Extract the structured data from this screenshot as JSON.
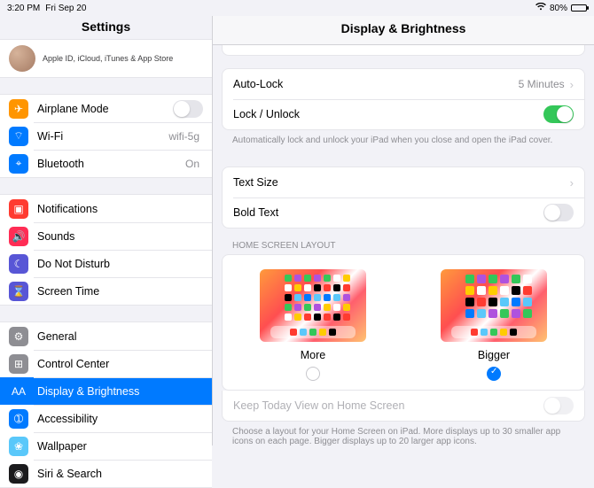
{
  "status": {
    "time": "3:20 PM",
    "date": "Fri Sep 20",
    "battery_pct": "80%"
  },
  "sidebar": {
    "title": "Settings",
    "profile_sub": "Apple ID, iCloud, iTunes & App Store",
    "g1": [
      {
        "label": "Airplane Mode",
        "icon": "✈︎",
        "bg": "#ff9500",
        "switch": "off"
      },
      {
        "label": "Wi-Fi",
        "icon": "⌔",
        "bg": "#007aff",
        "trail": "wifi-5g"
      },
      {
        "label": "Bluetooth",
        "icon": "⌖",
        "bg": "#007aff",
        "trail": "On"
      }
    ],
    "g2": [
      {
        "label": "Notifications",
        "icon": "▣",
        "bg": "#ff3b30"
      },
      {
        "label": "Sounds",
        "icon": "🔊",
        "bg": "#ff2d55"
      },
      {
        "label": "Do Not Disturb",
        "icon": "☾",
        "bg": "#5856d6"
      },
      {
        "label": "Screen Time",
        "icon": "⌛",
        "bg": "#5856d6"
      }
    ],
    "g3": [
      {
        "label": "General",
        "icon": "⚙",
        "bg": "#8e8e93"
      },
      {
        "label": "Control Center",
        "icon": "⊞",
        "bg": "#8e8e93"
      },
      {
        "label": "Display & Brightness",
        "icon": "AA",
        "bg": "#007aff",
        "selected": true
      },
      {
        "label": "Accessibility",
        "icon": "➀",
        "bg": "#007aff"
      },
      {
        "label": "Wallpaper",
        "icon": "❀",
        "bg": "#5ac8fa"
      },
      {
        "label": "Siri & Search",
        "icon": "◉",
        "bg": "#1b1b1d"
      }
    ]
  },
  "detail": {
    "title": "Display & Brightness",
    "autolock_label": "Auto-Lock",
    "autolock_value": "5 Minutes",
    "lockunlock_label": "Lock / Unlock",
    "lockunlock_note": "Automatically lock and unlock your iPad when you close and open the iPad cover.",
    "textsize_label": "Text Size",
    "boldtext_label": "Bold Text",
    "layout_header": "Home Screen Layout",
    "opt_more": "More",
    "opt_bigger": "Bigger",
    "selected_layout": "Bigger",
    "today_label": "Keep Today View on Home Screen",
    "layout_note": "Choose a layout for your Home Screen on iPad. More displays up to 30 smaller app icons on each page. Bigger displays up to 20 larger app icons."
  }
}
